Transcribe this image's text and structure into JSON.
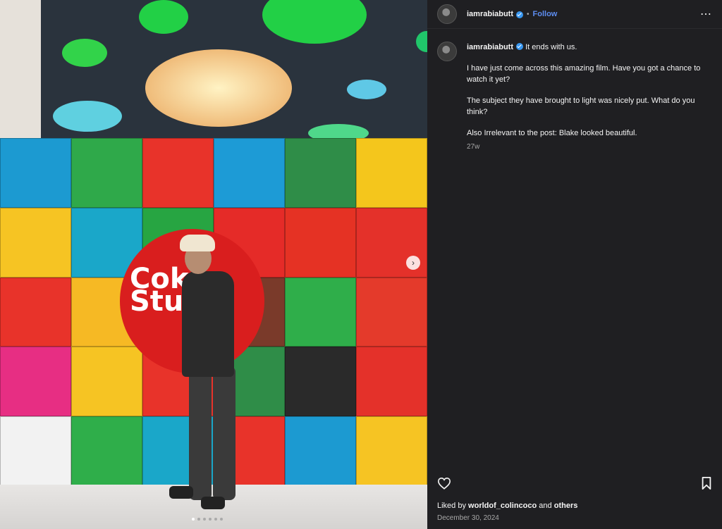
{
  "post": {
    "username": "iamrabiabutt",
    "follow_label": "Follow",
    "dot": "•",
    "more_icon": "more-options-icon",
    "caption_title": "It ends with us.",
    "caption_lines": [
      "I have just come across this amazing film. Have you got a chance to watch it yet?",
      "The subject they have brought to light was nicely put. What do you think?",
      "Also Irrelevant to the post: Blake looked beautiful."
    ],
    "caption_age": "27w",
    "liked_prefix": "Liked by",
    "liked_user": "worldof_colincoco",
    "liked_and": "and",
    "liked_others": "others",
    "date": "December 30, 2024"
  },
  "media": {
    "sign_text": "Coke Studio",
    "carousel_count": 6,
    "carousel_active": 1
  },
  "colors": {
    "accent_link": "#5d8df0",
    "verified": "#3897f0",
    "panel_bg": "#1f1f22"
  }
}
